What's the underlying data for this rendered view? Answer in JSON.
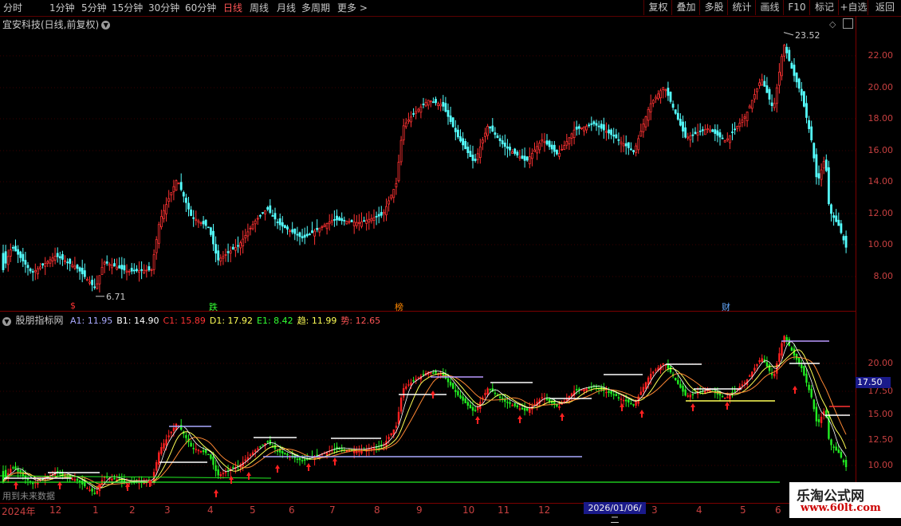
{
  "periods": [
    "分时",
    "1分钟",
    "5分钟",
    "15分钟",
    "30分钟",
    "60分钟",
    "日线",
    "周线",
    "月线",
    "多周期",
    "更多 >"
  ],
  "active_period": "日线",
  "right_buttons": [
    "复权",
    "叠加",
    "多股",
    "统计",
    "画线",
    "F10",
    "标记",
    "+自选",
    "返回"
  ],
  "stock_title": "宜安科技(日线,前复权)",
  "main_high": "23.52",
  "main_low": "6.71",
  "main_yticks": [
    "22.00",
    "20.00",
    "18.00",
    "16.00",
    "14.00",
    "12.00",
    "10.00",
    "8.00"
  ],
  "events": [
    {
      "t": "$",
      "c": "#ff3333"
    },
    {
      "t": "跌",
      "c": "#33ff33"
    },
    {
      "t": "榜",
      "c": "#ff8800"
    },
    {
      "t": "财",
      "c": "#66aaff"
    }
  ],
  "indicator": {
    "name": "股朋指标网",
    "items": [
      {
        "label": "A1: 11.95",
        "color": "#aaaaff"
      },
      {
        "label": "B1: 14.90",
        "color": "#ffffff"
      },
      {
        "label": "C1: 15.89",
        "color": "#ff3333"
      },
      {
        "label": "D1: 17.92",
        "color": "#ffff55"
      },
      {
        "label": "E1: 8.42",
        "color": "#33ff33"
      },
      {
        "label": "趋: 11.99",
        "color": "#ffff55"
      },
      {
        "label": "势: 12.65",
        "color": "#ff5555"
      }
    ]
  },
  "sub_yticks": [
    "20.00",
    "17.50",
    "15.00",
    "12.50",
    "10.00"
  ],
  "sub_badge": "17.50",
  "future_note": "用到未来数据",
  "date_labels": [
    "2024年",
    "12",
    "1",
    "2",
    "3",
    "4",
    "5",
    "6",
    "7",
    "8",
    "9",
    "10",
    "11",
    "12",
    "3",
    "4",
    "5",
    "6"
  ],
  "cursor_date": "2026/01/06/二",
  "watermark": {
    "title": "乐淘公式网",
    "url": "www.60lt.com"
  },
  "colors": {
    "up": "#ff3232",
    "down": "#54ffff",
    "grid": "#7a0000"
  }
}
